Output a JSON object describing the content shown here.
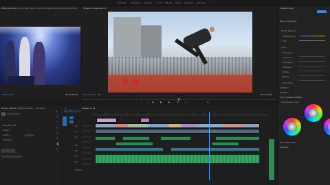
{
  "menu": {
    "tabs": [
      "Learning",
      "Assembly",
      "Editing",
      "Color",
      "Effects",
      "Audio",
      "Graphics",
      "Libraries"
    ]
  },
  "source": {
    "tabs": [
      "Effect Controls",
      "Audio Clip Mixer",
      "Lumetri Scopes",
      "Source: Audio Clip Mixer"
    ],
    "timecode": "00;00;00;00",
    "duration": "00;00;46;02"
  },
  "program": {
    "title": "Program: Sequence 01",
    "timecode": "00;00;41;13",
    "duration": "00;02;39;00",
    "fit": "Fit"
  },
  "lumetri": {
    "title": "Lumetri Color",
    "subtitle": "Basic Correction",
    "sections": [
      "White Balance",
      "Temperature",
      "Tint",
      "Tone",
      "Exposure",
      "Contrast",
      "Highlights",
      "Shadows",
      "Whites",
      "Blacks",
      "Saturation",
      "Creative",
      "Curves",
      "Color Wheels & Match",
      "HSL Secondary",
      "Vignette"
    ],
    "compare_label": "Comparison View"
  },
  "project": {
    "tabs": [
      "Project: Sports",
      "Media Browser",
      "Libraries"
    ],
    "items": [
      "Sports.prproj",
      "Sequence 01",
      "Track 1",
      "Audio 1",
      "Graphics"
    ]
  },
  "timeline": {
    "tab_label": "Sequence 01",
    "timecode": "00;00;41;13",
    "video_tracks": [
      "V3",
      "V2",
      "V1"
    ],
    "audio_tracks": [
      "A1",
      "A2",
      "A3",
      "A4",
      "Master"
    ]
  },
  "colors": {
    "accent": "#2d8ceb",
    "video_clip": "#8fa3c7",
    "video_clip_alt": "#c27cc4",
    "audio_clip": "#2f8a56",
    "playhead": "#4aa3ff"
  }
}
